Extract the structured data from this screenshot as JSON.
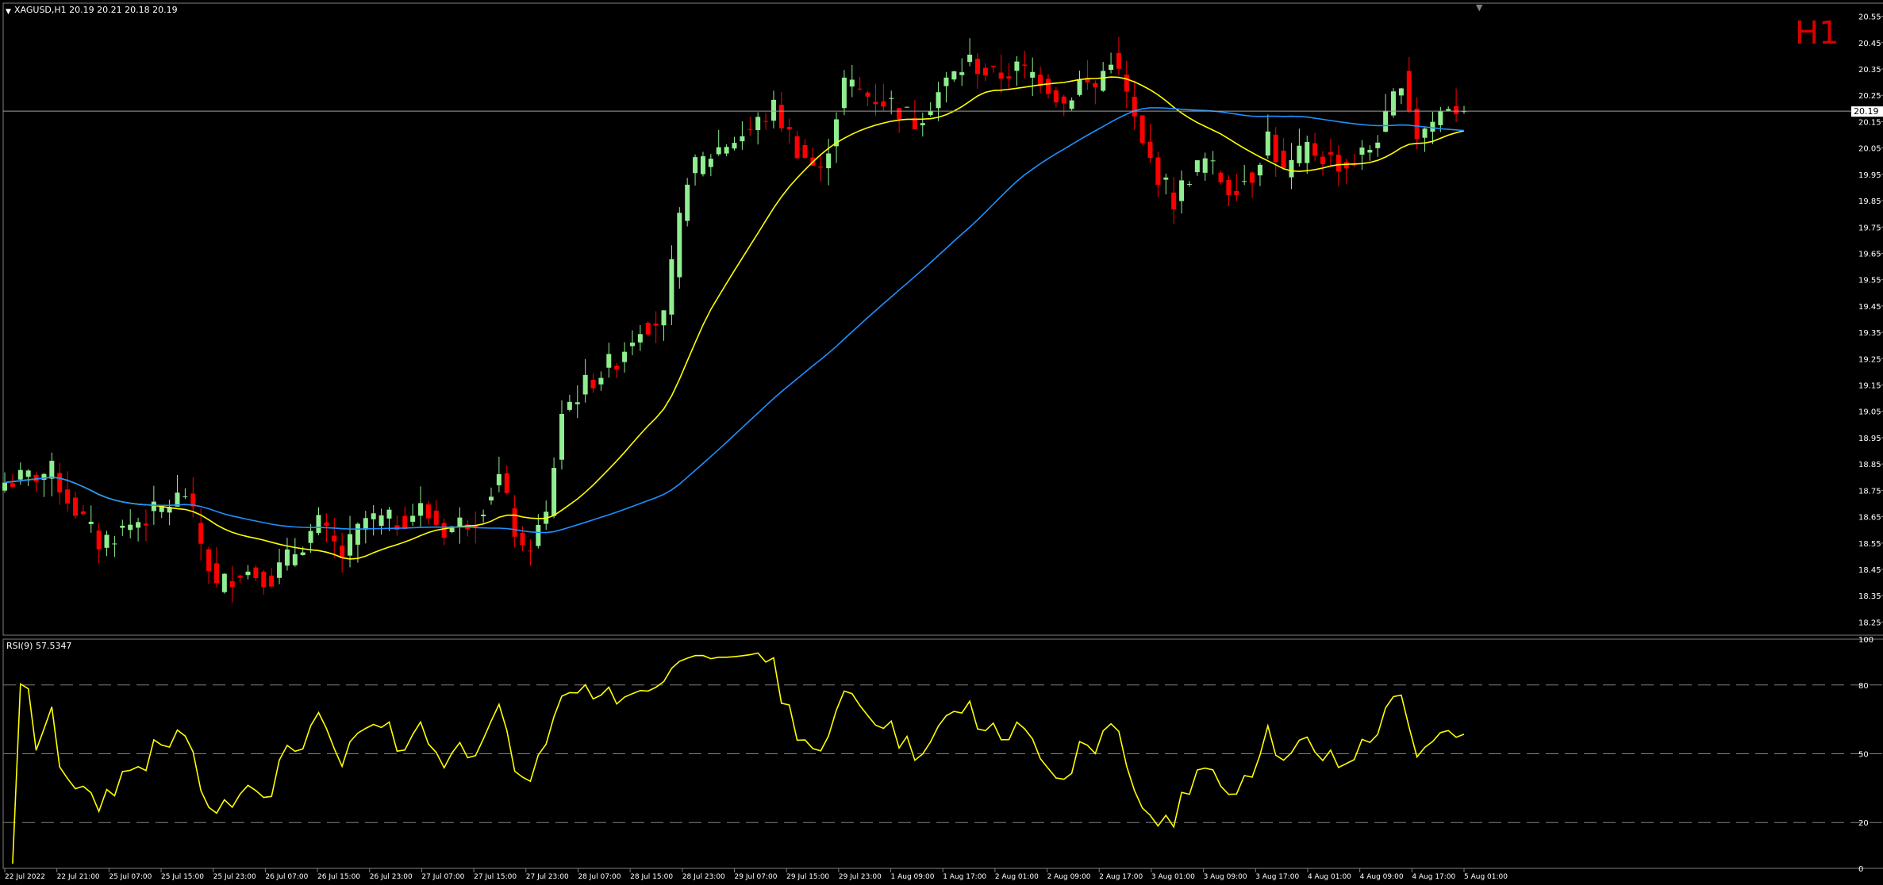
{
  "chart_data": [
    {
      "type": "candlestick",
      "header_label": "XAGUSD,H1  20.19 20.21 20.18 20.19",
      "timeframe_label": "H1",
      "current_price_label": "20.19",
      "current_price": 20.19,
      "ylim": [
        18.2,
        20.6
      ],
      "y_ticks": [
        "20.55",
        "20.45",
        "20.35",
        "20.25",
        "20.15",
        "20.05",
        "19.95",
        "19.85",
        "19.75",
        "19.65",
        "19.55",
        "19.45",
        "19.35",
        "19.25",
        "19.15",
        "19.05",
        "18.95",
        "18.85",
        "18.75",
        "18.65",
        "18.55",
        "18.45",
        "18.35",
        "18.25"
      ],
      "x_labels": [
        "22 Jul 2022",
        "22 Jul 21:00",
        "25 Jul 07:00",
        "25 Jul 15:00",
        "25 Jul 23:00",
        "26 Jul 07:00",
        "26 Jul 15:00",
        "26 Jul 23:00",
        "27 Jul 07:00",
        "27 Jul 15:00",
        "27 Jul 23:00",
        "28 Jul 07:00",
        "28 Jul 15:00",
        "28 Jul 23:00",
        "29 Jul 07:00",
        "29 Jul 15:00",
        "29 Jul 23:00",
        "1 Aug 09:00",
        "1 Aug 17:00",
        "2 Aug 01:00",
        "2 Aug 09:00",
        "2 Aug 17:00",
        "3 Aug 01:00",
        "3 Aug 09:00",
        "3 Aug 17:00",
        "4 Aug 01:00",
        "4 Aug 09:00",
        "4 Aug 17:00",
        "5 Aug 01:00"
      ],
      "close_anchors": [
        [
          0,
          18.78
        ],
        [
          6,
          18.82
        ],
        [
          8,
          18.72
        ],
        [
          12,
          18.55
        ],
        [
          16,
          18.62
        ],
        [
          20,
          18.68
        ],
        [
          23,
          18.74
        ],
        [
          25,
          18.55
        ],
        [
          27,
          18.38
        ],
        [
          30,
          18.45
        ],
        [
          34,
          18.42
        ],
        [
          37,
          18.52
        ],
        [
          40,
          18.62
        ],
        [
          43,
          18.5
        ],
        [
          46,
          18.64
        ],
        [
          50,
          18.63
        ],
        [
          53,
          18.68
        ],
        [
          56,
          18.6
        ],
        [
          60,
          18.65
        ],
        [
          63,
          18.8
        ],
        [
          66,
          18.5
        ],
        [
          69,
          18.65
        ],
        [
          71,
          19.05
        ],
        [
          74,
          19.15
        ],
        [
          78,
          19.25
        ],
        [
          81,
          19.38
        ],
        [
          84,
          19.4
        ],
        [
          87,
          19.95
        ],
        [
          91,
          20.05
        ],
        [
          95,
          20.12
        ],
        [
          98,
          20.2
        ],
        [
          101,
          20.05
        ],
        [
          104,
          19.95
        ],
        [
          107,
          20.3
        ],
        [
          110,
          20.25
        ],
        [
          113,
          20.22
        ],
        [
          116,
          20.15
        ],
        [
          120,
          20.3
        ],
        [
          123,
          20.38
        ],
        [
          126,
          20.32
        ],
        [
          129,
          20.35
        ],
        [
          132,
          20.32
        ],
        [
          135,
          20.22
        ],
        [
          137,
          20.3
        ],
        [
          139,
          20.28
        ],
        [
          141,
          20.4
        ],
        [
          143,
          20.25
        ],
        [
          145,
          20.05
        ],
        [
          147,
          19.95
        ],
        [
          149,
          19.85
        ],
        [
          151,
          19.95
        ],
        [
          153,
          20.0
        ],
        [
          156,
          19.9
        ],
        [
          159,
          19.95
        ],
        [
          161,
          20.1
        ],
        [
          163,
          19.95
        ],
        [
          166,
          20.05
        ],
        [
          168,
          20.02
        ],
        [
          171,
          19.98
        ],
        [
          174,
          20.05
        ],
        [
          176,
          20.15
        ],
        [
          178,
          20.32
        ],
        [
          180,
          20.1
        ],
        [
          182,
          20.15
        ],
        [
          184,
          20.22
        ],
        [
          186,
          20.19
        ]
      ],
      "series": [
        {
          "name": "",
          "type": "ma",
          "period": 20,
          "color": "#ffff00"
        },
        {
          "name": "",
          "type": "ma",
          "period": 60,
          "color": "#1e90ff"
        }
      ],
      "colors": {
        "bull": "#90ee90",
        "bear": "#ff0000",
        "grid": "#808080"
      }
    },
    {
      "type": "line",
      "indicator_label": "RSI(9) 57.5347",
      "ylim": [
        0,
        100
      ],
      "y_ticks": [
        "100",
        "80",
        "50",
        "20",
        "0"
      ],
      "levels": [
        80,
        50,
        20
      ],
      "color": "#ffff00"
    }
  ]
}
